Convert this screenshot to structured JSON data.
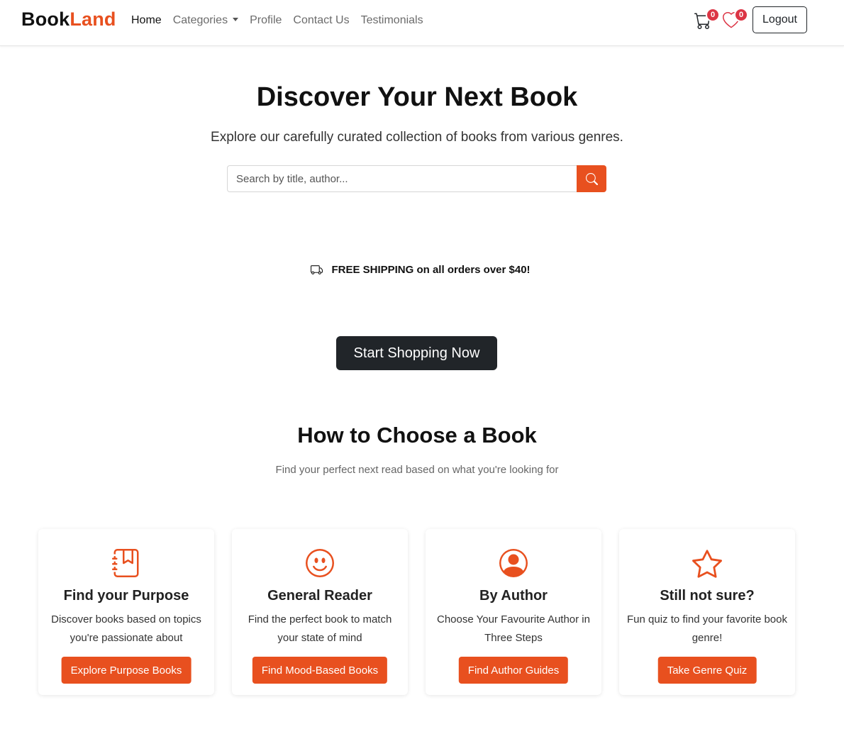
{
  "brand": {
    "part1": "Book",
    "part2": "Land"
  },
  "nav": {
    "links": [
      "Home",
      "Categories",
      "Profile",
      "Contact Us",
      "Testimonials"
    ],
    "cart_count": "0",
    "wishlist_count": "0",
    "logout_label": "Logout"
  },
  "hero": {
    "title": "Discover Your Next Book",
    "subtitle": "Explore our carefully curated collection of books from various genres.",
    "search_placeholder": "Search by title, author..."
  },
  "shipping": {
    "text": "FREE SHIPPING on all orders over $40!"
  },
  "cta": {
    "label": "Start Shopping Now"
  },
  "section": {
    "title": "How to Choose a Book",
    "subtitle": "Find your perfect next read based on what you're looking for"
  },
  "cards": [
    {
      "icon": "journal-bookmark-icon",
      "title": "Find your Purpose",
      "text": "Discover books based on topics you're passionate about",
      "button": "Explore Purpose Books"
    },
    {
      "icon": "smiley-face-icon",
      "title": "General Reader",
      "text": "Find the perfect book to match your state of mind",
      "button": "Find Mood-Based Books"
    },
    {
      "icon": "person-circle-icon",
      "title": "By Author",
      "text": "Choose Your Favourite Author in Three Steps",
      "button": "Find Author Guides"
    },
    {
      "icon": "star-icon",
      "title": "Still not sure?",
      "text": "Fun quiz to find your favorite book genre!",
      "button": "Take Genre Quiz"
    }
  ],
  "colors": {
    "accent": "#e8501f",
    "dark": "#212529",
    "badge": "#dc3545"
  }
}
